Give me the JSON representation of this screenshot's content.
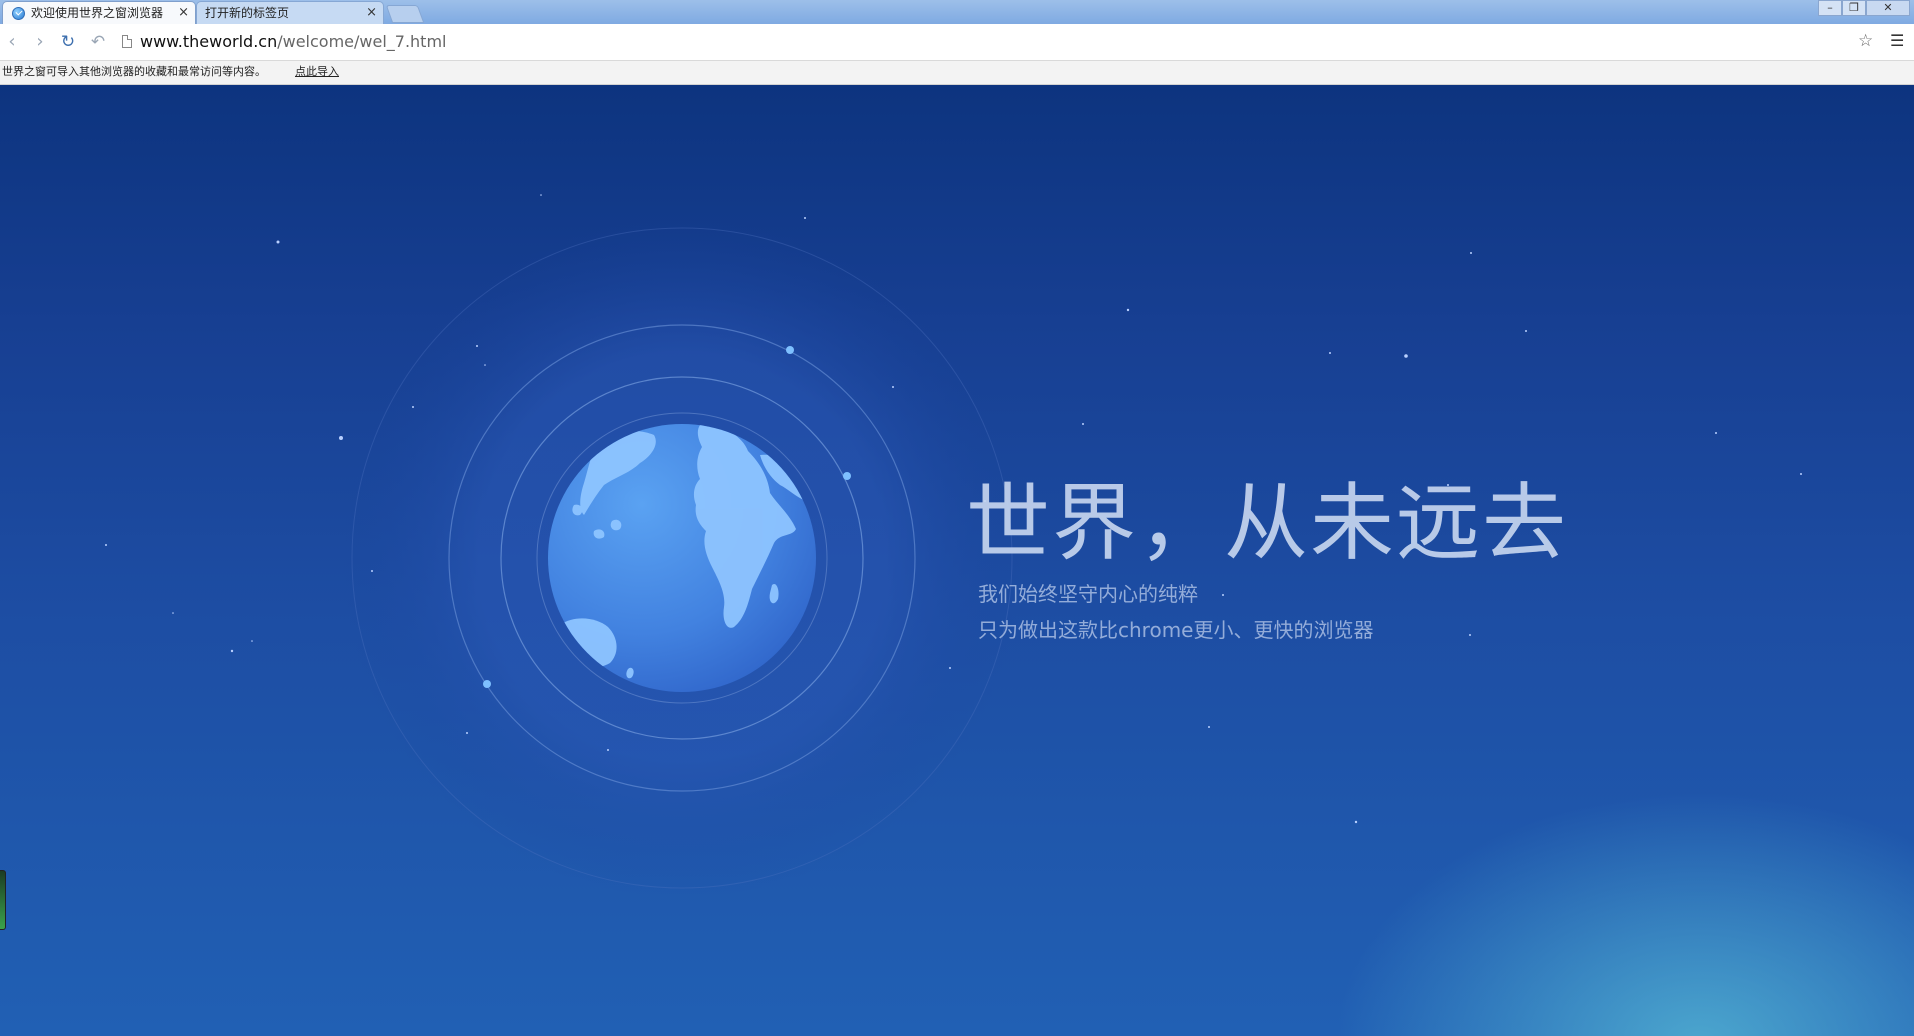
{
  "tabs": [
    {
      "title": "欢迎使用世界之窗浏览器",
      "close": "×"
    },
    {
      "title": "打开新的标签页",
      "close": "×"
    }
  ],
  "window_controls": {
    "minimize": "–",
    "maximize": "❐",
    "close": "✕"
  },
  "nav": {
    "back": "‹",
    "forward": "›",
    "reload": "↻",
    "undo": "↶"
  },
  "address": {
    "host": "www.theworld.cn",
    "path": "/welcome/wel_7.html"
  },
  "toolbar_icons": {
    "bookmark": "☆",
    "menu": "☰"
  },
  "infobar": {
    "message": "世界之窗可导入其他浏览器的收藏和最常访问等内容。",
    "link": "点此导入"
  },
  "hero": {
    "headline": "世界，从未远去",
    "line1": "我们始终坚守内心的纯粹",
    "line2": "只为做出这款比chrome更小、更快的浏览器"
  },
  "colors": {
    "background_top": "#0d347f",
    "background_bottom": "#2160b4",
    "globe": "#4a8ee6",
    "land": "#8ec4ff"
  },
  "icons": [
    "theworld-favicon",
    "back-icon",
    "forward-icon",
    "reload-icon",
    "undo-icon",
    "page-icon",
    "star-icon",
    "menu-icon",
    "globe-icon"
  ]
}
